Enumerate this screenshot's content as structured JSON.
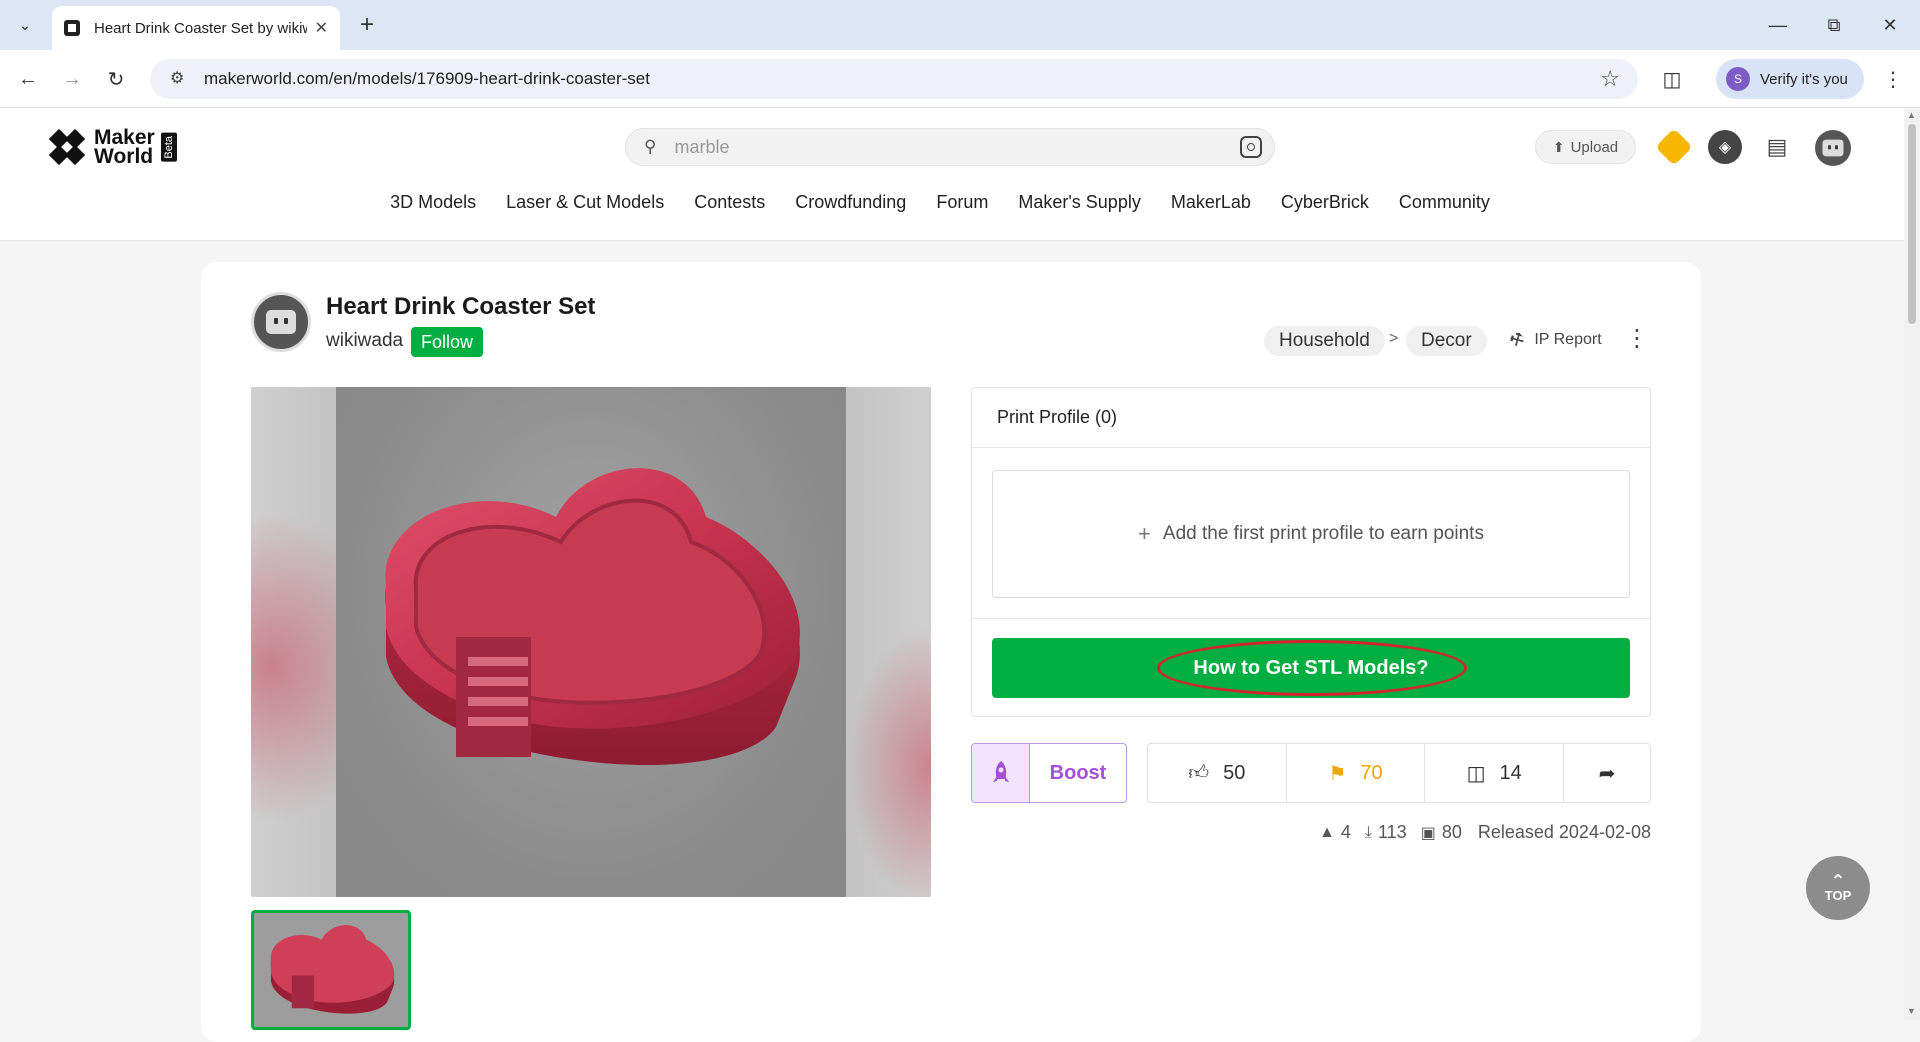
{
  "browser": {
    "tab_title": "Heart Drink Coaster Set by wikiwada",
    "url": "makerworld.com/en/models/176909-heart-drink-coaster-set",
    "verify_label": "Verify it's you",
    "verify_avatar_letter": "S"
  },
  "site": {
    "logo_line1": "Maker",
    "logo_line2": "World",
    "logo_badge": "Beta",
    "search_value": "marble",
    "upload_label": "Upload",
    "nav": [
      "3D Models",
      "Laser & Cut Models",
      "Contests",
      "Crowdfunding",
      "Forum",
      "Maker's Supply",
      "MakerLab",
      "CyberBrick",
      "Community"
    ]
  },
  "model": {
    "title": "Heart Drink Coaster Set",
    "author": "wikiwada",
    "follow_label": "Follow",
    "breadcrumb": [
      "Household",
      "Decor"
    ],
    "breadcrumb_sep": ">",
    "ip_report": "IP Report",
    "print_profile_header": "Print Profile (0)",
    "add_profile_text": "Add the first print profile to earn points",
    "stl_button": "How to Get STL Models?",
    "boost_label": "Boost",
    "likes": "50",
    "collects": "70",
    "comments": "14",
    "boosts_count": "4",
    "downloads": "113",
    "prints": "80",
    "released": "Released 2024-02-08"
  },
  "ui": {
    "top_label": "TOP",
    "accent_green": "#00ae42",
    "boost_purple": "#a44fd8",
    "collect_orange": "#f0a500",
    "highlight_red": "#d4232f"
  }
}
